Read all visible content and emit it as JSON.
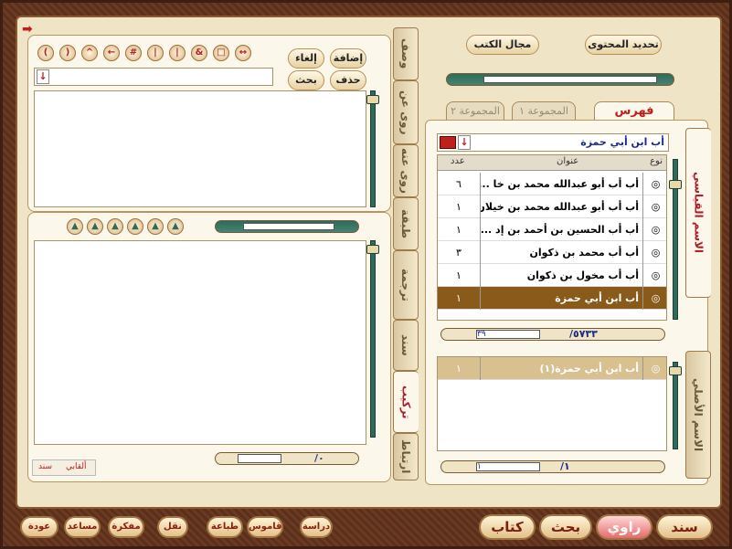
{
  "toolbar_left": {
    "add": "إضافة",
    "cancel": "إلغاء",
    "delete": "حذف",
    "search": "بحث",
    "symbols": [
      "(",
      ")",
      "^",
      "←",
      "#",
      "|",
      "|",
      "&",
      "□",
      "↔"
    ],
    "down_label": "↓"
  },
  "left_bottom": {
    "counter": "/٠",
    "tabs": [
      "سند",
      "ألقابي"
    ]
  },
  "vertical_tabs": [
    "وصف",
    "روى عن",
    "روى عنه",
    "طبقة",
    "ترجمة",
    "سند",
    "تركيب",
    "ارتباط"
  ],
  "right_top": {
    "define_content": "تحديد المحتوى",
    "book_scope": "مجال الكتب"
  },
  "right_tabs": [
    "فهرس",
    "المجموعة ١",
    "المجموعة ٢"
  ],
  "right_side_labels": [
    "الاسم القياسي",
    "الاسم الأصلي"
  ],
  "search_value": "أب ابن أبي حمزة",
  "table": {
    "headers": {
      "type": "نوع",
      "title": "عنوان",
      "count": "عدد"
    },
    "rows": [
      {
        "title": "أب أب أبو عبدالله محمد بن خا ...",
        "count": "٦"
      },
      {
        "title": "أب أب أبو عبدالله محمد بن خيلان",
        "count": "١"
      },
      {
        "title": "أب أب الحسين بن أحمد بن إد ...",
        "count": "١"
      },
      {
        "title": "أب أب محمد بن ذكوان",
        "count": "٣"
      },
      {
        "title": "أب أب مخول بن ذكوان",
        "count": "١"
      },
      {
        "title": "أب ابن أبي حمزة",
        "count": "١"
      }
    ],
    "selected_index": 5
  },
  "pager_top": {
    "total": "/٥٧٣٣",
    "current": "٣٩"
  },
  "lower_table": {
    "rows": [
      {
        "title": "أب ابن أبي حمزة(١)",
        "count": "١"
      }
    ]
  },
  "pager_bottom": {
    "total": "/١",
    "current": "١"
  },
  "bottom_bar": {
    "big": [
      "سند",
      "راوي",
      "بحث",
      "كتاب"
    ],
    "small": [
      "دراسة",
      "قاموس",
      "طباعة",
      "نقل",
      "مفكرة",
      "مساعد",
      "عودة"
    ]
  }
}
